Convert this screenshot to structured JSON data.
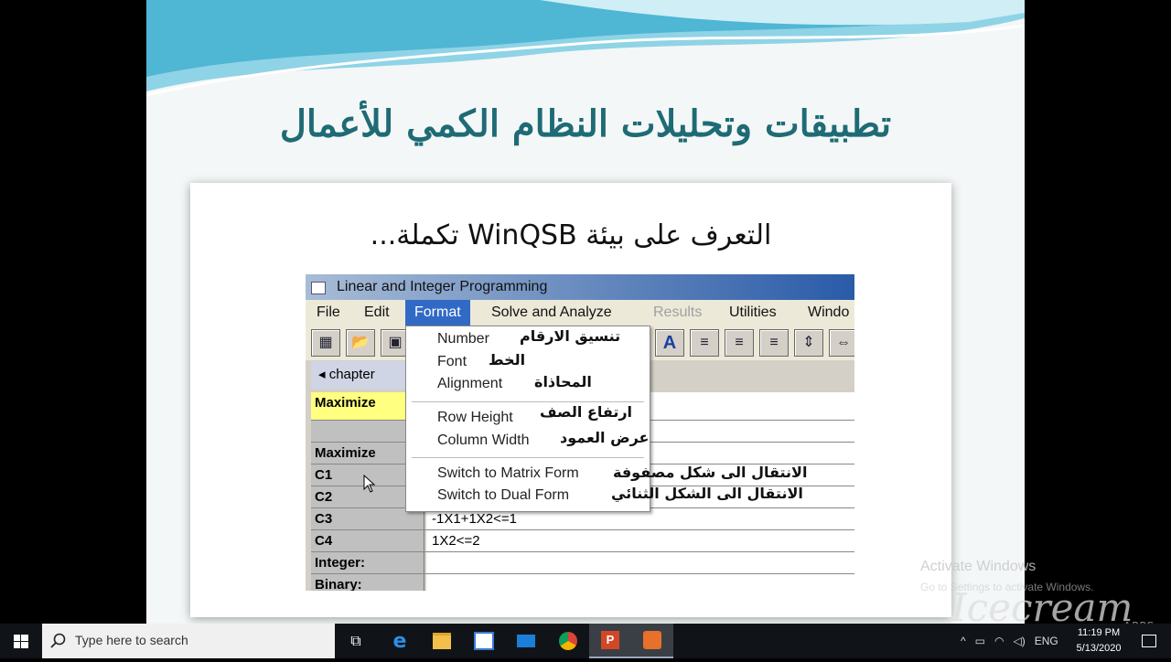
{
  "slide": {
    "title": "تطبيقات وتحليلات النظام الكمي للأعمال",
    "subtitle": "التعرف على بيئة WinQSB تكملة..."
  },
  "app": {
    "window_title": "Linear and Integer Programming",
    "menus": [
      "File",
      "Edit",
      "Format",
      "Solve and Analyze",
      "Results",
      "Utilities",
      "Windo"
    ],
    "active_menu": "Format",
    "disabled_menu": "Results",
    "child_title": "chapter",
    "grid": [
      {
        "label": "Maximize",
        "value": ""
      },
      {
        "label": "",
        "value": ""
      },
      {
        "label": "Maximize",
        "value": ""
      },
      {
        "label": "C1",
        "value": ""
      },
      {
        "label": "C2",
        "value": ""
      },
      {
        "label": "C3",
        "value": "-1X1+1X2<=1"
      },
      {
        "label": "C4",
        "value": "1X2<=2"
      },
      {
        "label": "Integer:",
        "value": ""
      },
      {
        "label": "Binary:",
        "value": ""
      }
    ]
  },
  "format_menu": {
    "items": [
      {
        "label": "Number",
        "arabic": "تنسيق الارقام"
      },
      {
        "label": "Font",
        "arabic": "الخط"
      },
      {
        "label": "Alignment",
        "arabic": "المحاذاة"
      },
      {
        "label": "Row Height",
        "arabic": "ارتفاع الصف"
      },
      {
        "label": "Column Width",
        "arabic": "عرض العمود"
      },
      {
        "label": "Switch to Matrix Form",
        "arabic": "الانتقال الى شكل مصفوفة"
      },
      {
        "label": "Switch to Dual Form",
        "arabic": "الانتقال الى الشكل الثنائي"
      }
    ]
  },
  "watermark": {
    "activate_title": "Activate Windows",
    "activate_sub": "Go to Settings to activate Windows.",
    "brand": "Icecream",
    "brand_sub": "APPS"
  },
  "taskbar": {
    "search_placeholder": "Type here to search",
    "language": "ENG",
    "time": "11:19 PM",
    "date": "5/13/2020"
  }
}
